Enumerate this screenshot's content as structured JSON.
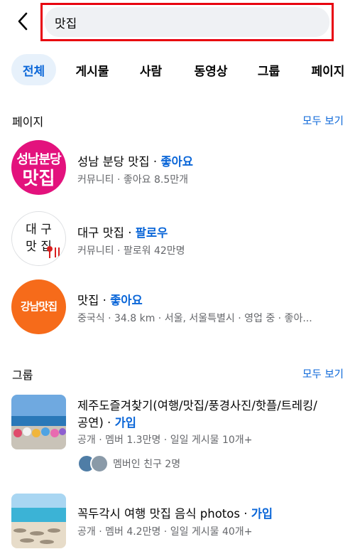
{
  "search": {
    "query": "맛집"
  },
  "tabs": [
    {
      "label": "전체"
    },
    {
      "label": "게시물"
    },
    {
      "label": "사람"
    },
    {
      "label": "동영상"
    },
    {
      "label": "그룹"
    },
    {
      "label": "페이지"
    }
  ],
  "pages_section": {
    "title": "페이지",
    "see_all": "모두 보기",
    "items": [
      {
        "avatar_text_1": "성남분당",
        "avatar_text_2": "맛집",
        "name": "성남 분당 맛집",
        "separator": " · ",
        "action": "좋아요",
        "meta": "커뮤니티 · 좋아요 8.5만개"
      },
      {
        "avatar_text_1": "대 구",
        "avatar_text_2": "맛 집",
        "name": "대구 맛집",
        "separator": " · ",
        "action": "팔로우",
        "meta": "커뮤니티 · 팔로워 42만명"
      },
      {
        "avatar_text_1": "강남맛집",
        "name": "맛집",
        "separator": " · ",
        "action": "좋아요",
        "meta": "중국식 · 34.8 km · 서울, 서울특별시 · 영업 중 · 좋아..."
      }
    ]
  },
  "groups_section": {
    "title": "그룹",
    "see_all": "모두 보기",
    "items": [
      {
        "name_line1": "제주도즐겨찾기(여행/맛집/풍경사진/핫플/트레킹/",
        "name_line2": "공연)",
        "separator": " · ",
        "action": "가입",
        "meta": "공개 · 멤버 1.3만명 · 일일 게시물 10개+",
        "friends": "멤버인 친구 2명"
      },
      {
        "name_line1": "꼭두각시 여행 맛집 음식 photos",
        "separator": " · ",
        "action": "가입",
        "meta": "공개 · 멤버 4.2만명 · 일일 게시물 40개+"
      }
    ]
  },
  "colors": {
    "accent": "#0a66d8",
    "highlight_border": "#e8000f",
    "secondary_text": "#65676b",
    "tab_active_bg": "#e7f1fb"
  }
}
